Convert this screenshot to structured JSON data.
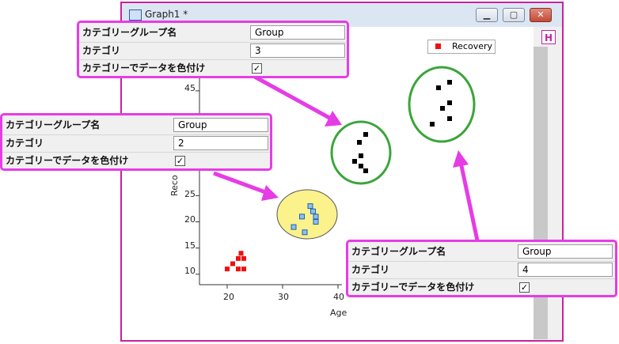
{
  "window": {
    "title": "Graph1 *",
    "minimize_glyph": "▁",
    "maximize_glyph": "▢",
    "close_glyph": "✕",
    "h_button": "H"
  },
  "legend": {
    "label": "Recovery",
    "color": "#ee1111"
  },
  "axes": {
    "xlabel": "Age",
    "ylabel_partial": "Reco",
    "x_ticks": [
      "20",
      "30",
      "40"
    ],
    "y_ticks": [
      "45",
      "25",
      "20",
      "15",
      "10"
    ]
  },
  "panels": [
    {
      "group_label": "カテゴリーグループ名",
      "group_value": "Group",
      "category_label": "カテゴリ",
      "category_value": "3",
      "color_label": "カテゴリーでデータを色付け",
      "checked": "✓"
    },
    {
      "group_label": "カテゴリーグループ名",
      "group_value": "Group",
      "category_label": "カテゴリ",
      "category_value": "2",
      "color_label": "カテゴリーでデータを色付け",
      "checked": "✓"
    },
    {
      "group_label": "カテゴリーグループ名",
      "group_value": "Group",
      "category_label": "カテゴリ",
      "category_value": "4",
      "color_label": "カテゴリーでデータを色付け",
      "checked": "✓"
    }
  ],
  "colors": {
    "accent_magenta": "#e63ce6",
    "window_border": "#c6239f",
    "circle_green": "#3aa53a",
    "ellipse_fill": "#fbf28c",
    "category1_red": "#ee1111",
    "category2_blue": "#8fc0ee",
    "category_black": "#000000"
  },
  "chart_data": {
    "type": "scatter",
    "xlabel": "Age",
    "ylabel": "",
    "xlim": [
      15,
      45
    ],
    "ylim": [
      8,
      48
    ],
    "series": [
      {
        "name": "Recovery",
        "color": "#ee1111",
        "x": [
          20,
          21,
          22,
          22.5,
          23,
          23,
          22
        ],
        "y": [
          11,
          12,
          13,
          14,
          13,
          11,
          11
        ]
      },
      {
        "color": "#8fc0ee",
        "x": [
          32,
          33.5,
          34,
          35,
          35.5,
          36,
          36
        ],
        "y": [
          19,
          21,
          18,
          23,
          22,
          20,
          21
        ]
      }
    ]
  }
}
